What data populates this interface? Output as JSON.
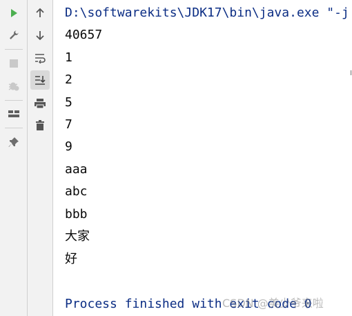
{
  "console": {
    "command_line": "D:\\softwarekits\\JDK17\\bin\\java.exe \"-j",
    "output_lines": [
      "40657",
      "1",
      "2",
      "5",
      "7",
      "9",
      "aaa",
      "abc",
      "bbb",
      "大家",
      "好"
    ],
    "exit_line": "Process finished with exit code 0"
  },
  "watermark": "CSDN @美少爷来啦",
  "icons": {
    "left_toolbar": [
      "run-icon",
      "wrench-icon",
      "stop-icon",
      "debug-bug-icon",
      "layout-icon",
      "pin-icon"
    ],
    "right_toolbar": [
      "up-arrow-icon",
      "down-arrow-icon",
      "soft-wrap-icon",
      "scroll-to-end-icon",
      "print-icon",
      "trash-icon"
    ]
  },
  "colors": {
    "run_green": "#4caf50",
    "command_blue": "#0b2d84",
    "toolbar_bg": "#f2f2f2"
  }
}
